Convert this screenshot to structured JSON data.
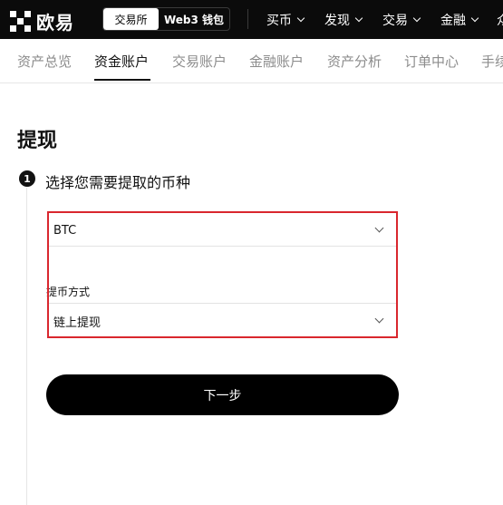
{
  "brand": {
    "name": "欧易"
  },
  "switcher": {
    "exchange": "交易所",
    "wallet": "Web3 钱包"
  },
  "topnav": [
    {
      "label": "买币"
    },
    {
      "label": "发现"
    },
    {
      "label": "交易"
    },
    {
      "label": "金融"
    },
    {
      "label": "众"
    }
  ],
  "subnav": [
    {
      "label": "资产总览"
    },
    {
      "label": "资金账户",
      "active": true
    },
    {
      "label": "交易账户"
    },
    {
      "label": "金融账户"
    },
    {
      "label": "资产分析"
    },
    {
      "label": "订单中心"
    },
    {
      "label": "手续"
    }
  ],
  "page": {
    "title": "提现"
  },
  "step": {
    "number": "1",
    "title": "选择您需要提取的币种"
  },
  "form": {
    "coin_value": "BTC",
    "method_label": "提币方式",
    "method_value": "链上提现",
    "next_label": "下一步"
  },
  "colors": {
    "highlight": "#d9272e",
    "topbar": "#0b0b0b",
    "button": "#000000"
  }
}
